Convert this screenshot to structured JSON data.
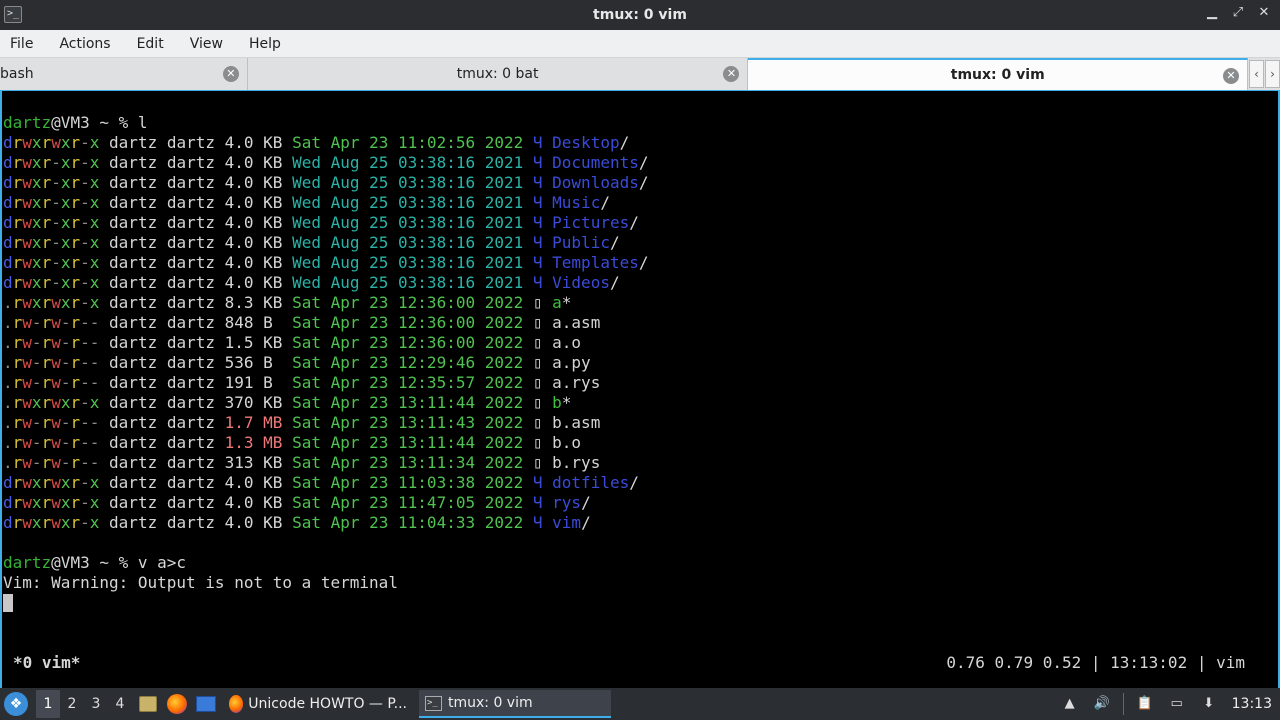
{
  "window": {
    "title": "tmux: 0 vim",
    "icon": "terminal-icon",
    "controls": {
      "minimize": "▁",
      "maximize": "⤢",
      "close": "✕"
    }
  },
  "menubar": [
    "File",
    "Actions",
    "Edit",
    "View",
    "Help"
  ],
  "tabs": [
    {
      "label": "bash",
      "active": false
    },
    {
      "label": "tmux: 0 bat",
      "active": false
    },
    {
      "label": "tmux: 0 vim",
      "active": true
    }
  ],
  "tab_scroll": {
    "left": "‹",
    "right": "›"
  },
  "terminal": {
    "prompt1": {
      "user": "dartz",
      "host": "@VM3 ~ % ",
      "cmd": "l"
    },
    "listing": [
      {
        "perm": "drwxrwxr-x",
        "owner": "dartz dartz",
        "size": "4.0 KB",
        "date": "Sat Apr 23 11:02:56 2022",
        "icon": "Ч",
        "name": "Desktop",
        "suffix": "/",
        "kind": "dir"
      },
      {
        "perm": "drwxr-xr-x",
        "owner": "dartz dartz",
        "size": "4.0 KB",
        "date": "Wed Aug 25 03:38:16 2021",
        "icon": "Ч",
        "name": "Documents",
        "suffix": "/",
        "kind": "dir"
      },
      {
        "perm": "drwxr-xr-x",
        "owner": "dartz dartz",
        "size": "4.0 KB",
        "date": "Wed Aug 25 03:38:16 2021",
        "icon": "Ч",
        "name": "Downloads",
        "suffix": "/",
        "kind": "dir"
      },
      {
        "perm": "drwxr-xr-x",
        "owner": "dartz dartz",
        "size": "4.0 KB",
        "date": "Wed Aug 25 03:38:16 2021",
        "icon": "Ч",
        "name": "Music",
        "suffix": "/",
        "kind": "dir"
      },
      {
        "perm": "drwxr-xr-x",
        "owner": "dartz dartz",
        "size": "4.0 KB",
        "date": "Wed Aug 25 03:38:16 2021",
        "icon": "Ч",
        "name": "Pictures",
        "suffix": "/",
        "kind": "dir"
      },
      {
        "perm": "drwxr-xr-x",
        "owner": "dartz dartz",
        "size": "4.0 KB",
        "date": "Wed Aug 25 03:38:16 2021",
        "icon": "Ч",
        "name": "Public",
        "suffix": "/",
        "kind": "dir"
      },
      {
        "perm": "drwxr-xr-x",
        "owner": "dartz dartz",
        "size": "4.0 KB",
        "date": "Wed Aug 25 03:38:16 2021",
        "icon": "Ч",
        "name": "Templates",
        "suffix": "/",
        "kind": "dir"
      },
      {
        "perm": "drwxr-xr-x",
        "owner": "dartz dartz",
        "size": "4.0 KB",
        "date": "Wed Aug 25 03:38:16 2021",
        "icon": "Ч",
        "name": "Videos",
        "suffix": "/",
        "kind": "dir"
      },
      {
        "perm": ".rwxrwxr-x",
        "owner": "dartz dartz",
        "size": "8.3 KB",
        "date": "Sat Apr 23 12:36:00 2022",
        "icon": "▯",
        "name": "a",
        "suffix": "*",
        "kind": "exe"
      },
      {
        "perm": ".rw-rw-r--",
        "owner": "dartz dartz",
        "size": "848 B ",
        "date": "Sat Apr 23 12:36:00 2022",
        "icon": "▯",
        "name": "a.asm",
        "suffix": "",
        "kind": "file"
      },
      {
        "perm": ".rw-rw-r--",
        "owner": "dartz dartz",
        "size": "1.5 KB",
        "date": "Sat Apr 23 12:36:00 2022",
        "icon": "▯",
        "name": "a.o",
        "suffix": "",
        "kind": "file"
      },
      {
        "perm": ".rw-rw-r--",
        "owner": "dartz dartz",
        "size": "536 B ",
        "date": "Sat Apr 23 12:29:46 2022",
        "icon": "▯",
        "name": "a.py",
        "suffix": "",
        "kind": "file"
      },
      {
        "perm": ".rw-rw-r--",
        "owner": "dartz dartz",
        "size": "191 B ",
        "date": "Sat Apr 23 12:35:57 2022",
        "icon": "▯",
        "name": "a.rys",
        "suffix": "",
        "kind": "file"
      },
      {
        "perm": ".rwxrwxr-x",
        "owner": "dartz dartz",
        "size": "370 KB",
        "date": "Sat Apr 23 13:11:44 2022",
        "icon": "▯",
        "name": "b",
        "suffix": "*",
        "kind": "exe"
      },
      {
        "perm": ".rw-rw-r--",
        "owner": "dartz dartz",
        "size": "1.7 MB",
        "date": "Sat Apr 23 13:11:43 2022",
        "icon": "▯",
        "name": "b.asm",
        "suffix": "",
        "kind": "file",
        "bigsize": true
      },
      {
        "perm": ".rw-rw-r--",
        "owner": "dartz dartz",
        "size": "1.3 MB",
        "date": "Sat Apr 23 13:11:44 2022",
        "icon": "▯",
        "name": "b.o",
        "suffix": "",
        "kind": "file",
        "bigsize": true
      },
      {
        "perm": ".rw-rw-r--",
        "owner": "dartz dartz",
        "size": "313 KB",
        "date": "Sat Apr 23 13:11:34 2022",
        "icon": "▯",
        "name": "b.rys",
        "suffix": "",
        "kind": "file"
      },
      {
        "perm": "drwxrwxr-x",
        "owner": "dartz dartz",
        "size": "4.0 KB",
        "date": "Sat Apr 23 11:03:38 2022",
        "icon": "Ч",
        "name": "dotfiles",
        "suffix": "/",
        "kind": "dir"
      },
      {
        "perm": "drwxrwxr-x",
        "owner": "dartz dartz",
        "size": "4.0 KB",
        "date": "Sat Apr 23 11:47:05 2022",
        "icon": "Ч",
        "name": "rys",
        "suffix": "/",
        "kind": "dir"
      },
      {
        "perm": "drwxrwxr-x",
        "owner": "dartz dartz",
        "size": "4.0 KB",
        "date": "Sat Apr 23 11:04:33 2022",
        "icon": "Ч",
        "name": "vim",
        "suffix": "/",
        "kind": "dir"
      }
    ],
    "prompt2": {
      "user": "dartz",
      "host": "@VM3 ~ % ",
      "cmd": "v a>c"
    },
    "warning": "Vim: Warning: Output is not to a terminal"
  },
  "tmux_status": {
    "left": "*0 vim*",
    "right": "0.76 0.79 0.52 | 13:13:02 | vim"
  },
  "taskbar": {
    "launcher_icon": "app-launcher-icon",
    "workspaces": [
      "1",
      "2",
      "3",
      "4"
    ],
    "active_workspace": "1",
    "tasks": [
      {
        "label": "Unicode HOWTO — P...",
        "icon": "firefox-icon",
        "active": false
      },
      {
        "label": "tmux: 0 vim",
        "icon": "terminal-icon",
        "active": true
      }
    ],
    "clock": "13:13"
  },
  "colors": {
    "accent": "#3daee9",
    "user": "#36b336",
    "dir": "#3b4bd8",
    "date": "#2bb3a7",
    "exe": "#3cc13c"
  }
}
